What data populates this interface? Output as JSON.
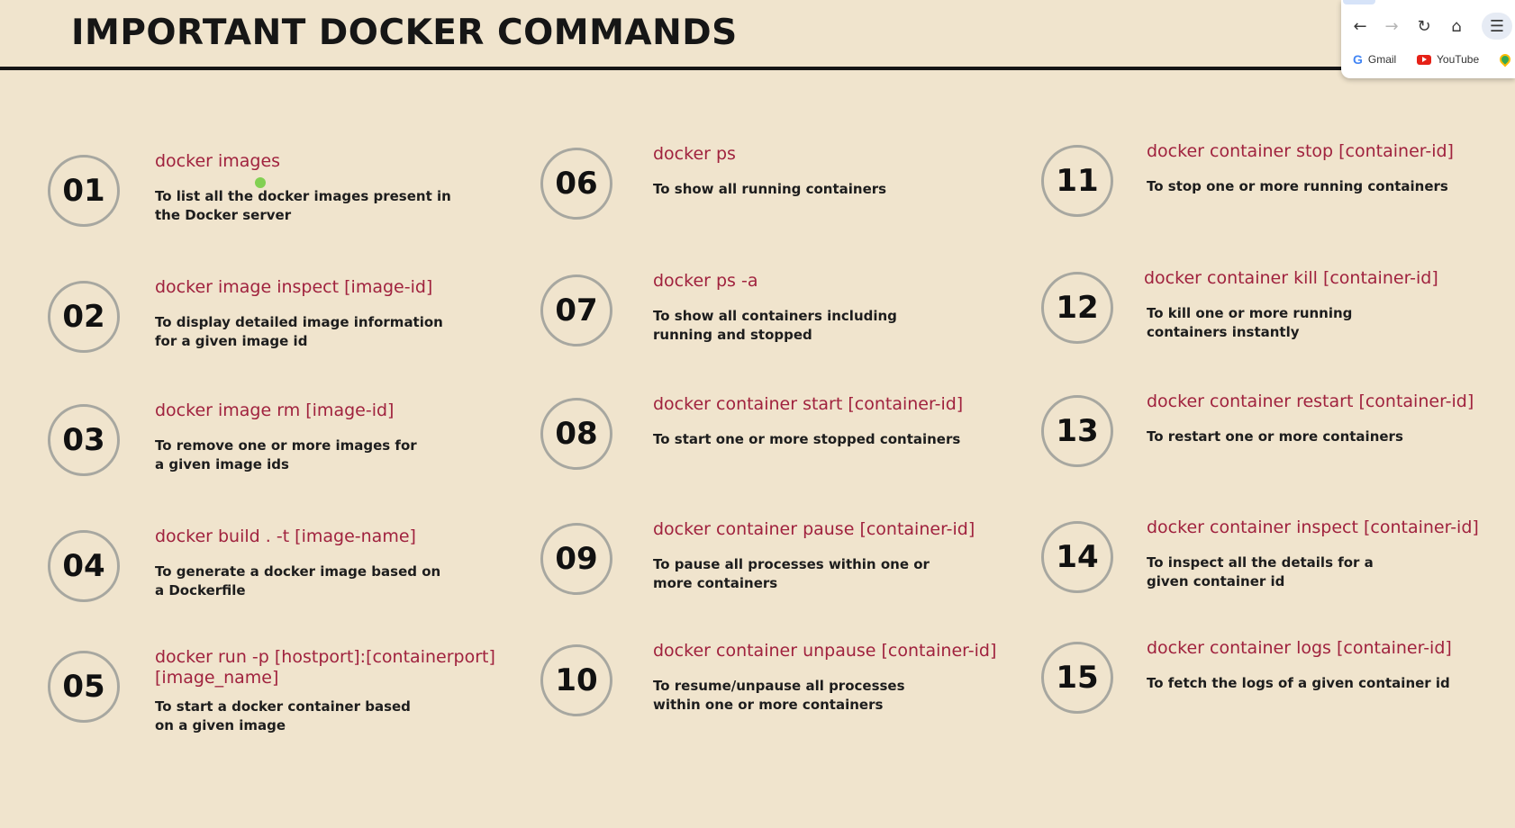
{
  "title": "IMPORTANT DOCKER COMMANDS",
  "columns": [
    [
      {
        "num": "01",
        "cmd": "docker images",
        "desc": "To list all the docker images present in the Docker server"
      },
      {
        "num": "02",
        "cmd": "docker image inspect [image-id]",
        "desc": "To display detailed image information for a given image id"
      },
      {
        "num": "03",
        "cmd": "docker image rm [image-id]",
        "desc": "To remove one or more images for a given image ids"
      },
      {
        "num": "04",
        "cmd": "docker build . -t [image-name]",
        "desc": "To generate a docker image based on a Dockerfile"
      },
      {
        "num": "05",
        "cmd": "docker run -p [hostport]:[containerport] [image_name]",
        "desc": "To start a docker container based on a given image"
      }
    ],
    [
      {
        "num": "06",
        "cmd": "docker ps",
        "desc": "To show all running containers"
      },
      {
        "num": "07",
        "cmd": "docker ps -a",
        "desc": "To show all containers including running and stopped"
      },
      {
        "num": "08",
        "cmd": "docker container start [container-id]",
        "desc": "To start one or more stopped containers"
      },
      {
        "num": "09",
        "cmd": "docker container pause [container-id]",
        "desc": "To pause all processes within one or more containers"
      },
      {
        "num": "10",
        "cmd": "docker container unpause [container-id]",
        "desc": "To resume/unpause all processes within one or more containers"
      }
    ],
    [
      {
        "num": "11",
        "cmd": "docker container stop [container-id]",
        "desc": "To stop one or more running containers"
      },
      {
        "num": "12",
        "cmd": "docker container kill [container-id]",
        "desc": "To kill one or more running containers instantly"
      },
      {
        "num": "13",
        "cmd": "docker container restart [container-id]",
        "desc": "To restart one or more containers"
      },
      {
        "num": "14",
        "cmd": "docker container inspect [container-id]",
        "desc": "To inspect all the details for a given container id"
      },
      {
        "num": "15",
        "cmd": "docker container logs [container-id]",
        "desc": "To fetch the logs of a given container id"
      }
    ]
  ],
  "browser": {
    "bookmarks": [
      {
        "icon": "google-icon",
        "label": "Gmail"
      },
      {
        "icon": "youtube-icon",
        "label": "YouTube"
      },
      {
        "icon": "maps-icon",
        "label": ""
      }
    ],
    "nav_icons": [
      "back-arrow-icon",
      "forward-arrow-icon",
      "reload-icon",
      "home-icon",
      "extensions-icon"
    ]
  },
  "colors": {
    "background": "#f0e4cd",
    "command_text": "#a0223e",
    "circle_border": "#a7a7a0"
  }
}
